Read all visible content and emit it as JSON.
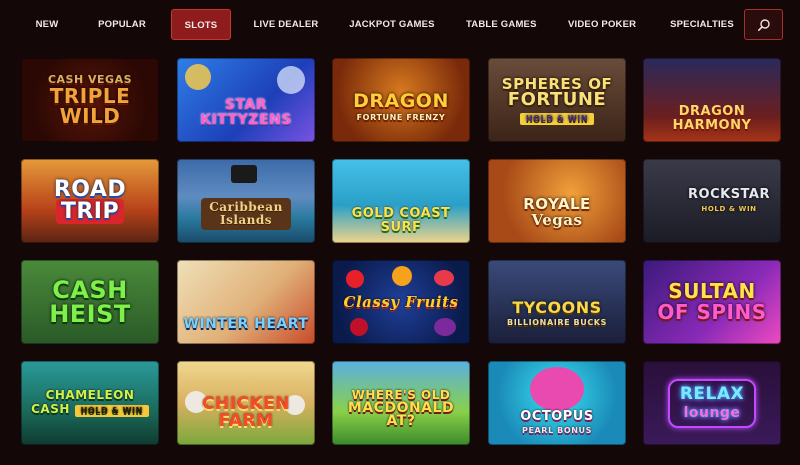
{
  "nav": {
    "tabs": [
      {
        "label": "NEW"
      },
      {
        "label": "POPULAR"
      },
      {
        "label": "SLOTS"
      },
      {
        "label": "LIVE DEALER"
      },
      {
        "label": "JACKPOT GAMES"
      },
      {
        "label": "TABLE GAMES"
      },
      {
        "label": "VIDEO POKER"
      },
      {
        "label": "SPECIALTIES"
      }
    ],
    "active_tab": "SLOTS",
    "search_icon": "search-icon"
  },
  "games": [
    {
      "title": "CASH VEGAS TRIPLE WILD",
      "line1": "CASH VEGAS",
      "line2": "TRIPLE WILD",
      "sub": ""
    },
    {
      "title": "STAR KITTYZENS",
      "line1": "STAR",
      "line2": "KITTYZENS",
      "sub": ""
    },
    {
      "title": "DRAGON FORTUNE FRENZY",
      "line1": "DRAGON",
      "line2": "",
      "sub": "FORTUNE FRENZY"
    },
    {
      "title": "SPHERES OF FORTUNE",
      "line1": "SPHERES OF",
      "line2": "FORTUNE",
      "sub": "HOLD & WIN"
    },
    {
      "title": "DRAGON HARMONY",
      "line1": "DRAGON",
      "line2": "HARMONY",
      "sub": ""
    },
    {
      "title": "ROAD TRIP",
      "line1": "ROAD",
      "line2": "TRIP",
      "sub": ""
    },
    {
      "title": "CARIBBEAN ISLANDS",
      "line1": "Caribbean",
      "line2": "Islands",
      "sub": ""
    },
    {
      "title": "GOLD COAST SURF",
      "line1": "GOLD COAST SURF",
      "line2": "",
      "sub": ""
    },
    {
      "title": "ROYALE VEGAS",
      "line1": "ROYALE",
      "line2": "Vegas",
      "sub": ""
    },
    {
      "title": "ROCKSTAR",
      "line1": "ROCKSTAR",
      "line2": "",
      "sub": "HOLD & WIN"
    },
    {
      "title": "CASH HEIST",
      "line1": "CASH",
      "line2": "HEIST",
      "sub": ""
    },
    {
      "title": "WINTER HEART",
      "line1": "WINTER HEART",
      "line2": "",
      "sub": ""
    },
    {
      "title": "CLASSY FRUITS",
      "line1": "Classy Fruits",
      "line2": "",
      "sub": ""
    },
    {
      "title": "TYCOONS BILLIONAIRE BUCKS",
      "line1": "TYCOONS",
      "line2": "",
      "sub": "BILLIONAIRE BUCKS"
    },
    {
      "title": "SULTAN OF SPINS",
      "line1": "SULTAN",
      "line2": "OF SPINS",
      "sub": ""
    },
    {
      "title": "CHAMELEON CASH",
      "line1": "CHAMELEON CASH",
      "line2": "",
      "sub": "HOLD & WIN"
    },
    {
      "title": "CHICKEN FARM",
      "line1": "CHICKEN",
      "line2": "FARM",
      "sub": ""
    },
    {
      "title": "WHERE'S OLD MACDONALD AT?",
      "line1": "WHERE'S OLD",
      "line2": "MACDONALD AT?",
      "sub": ""
    },
    {
      "title": "OCTOPUS PEARL BONUS",
      "line1": "OCTOPUS",
      "line2": "",
      "sub": "PEARL BONUS"
    },
    {
      "title": "RELAX LOUNGE",
      "line1": "RELAX",
      "line2": "lounge",
      "sub": ""
    }
  ],
  "colors": {
    "background": "#140707",
    "active_tab": "#8f1c1c",
    "accent_border": "#c0392b"
  }
}
